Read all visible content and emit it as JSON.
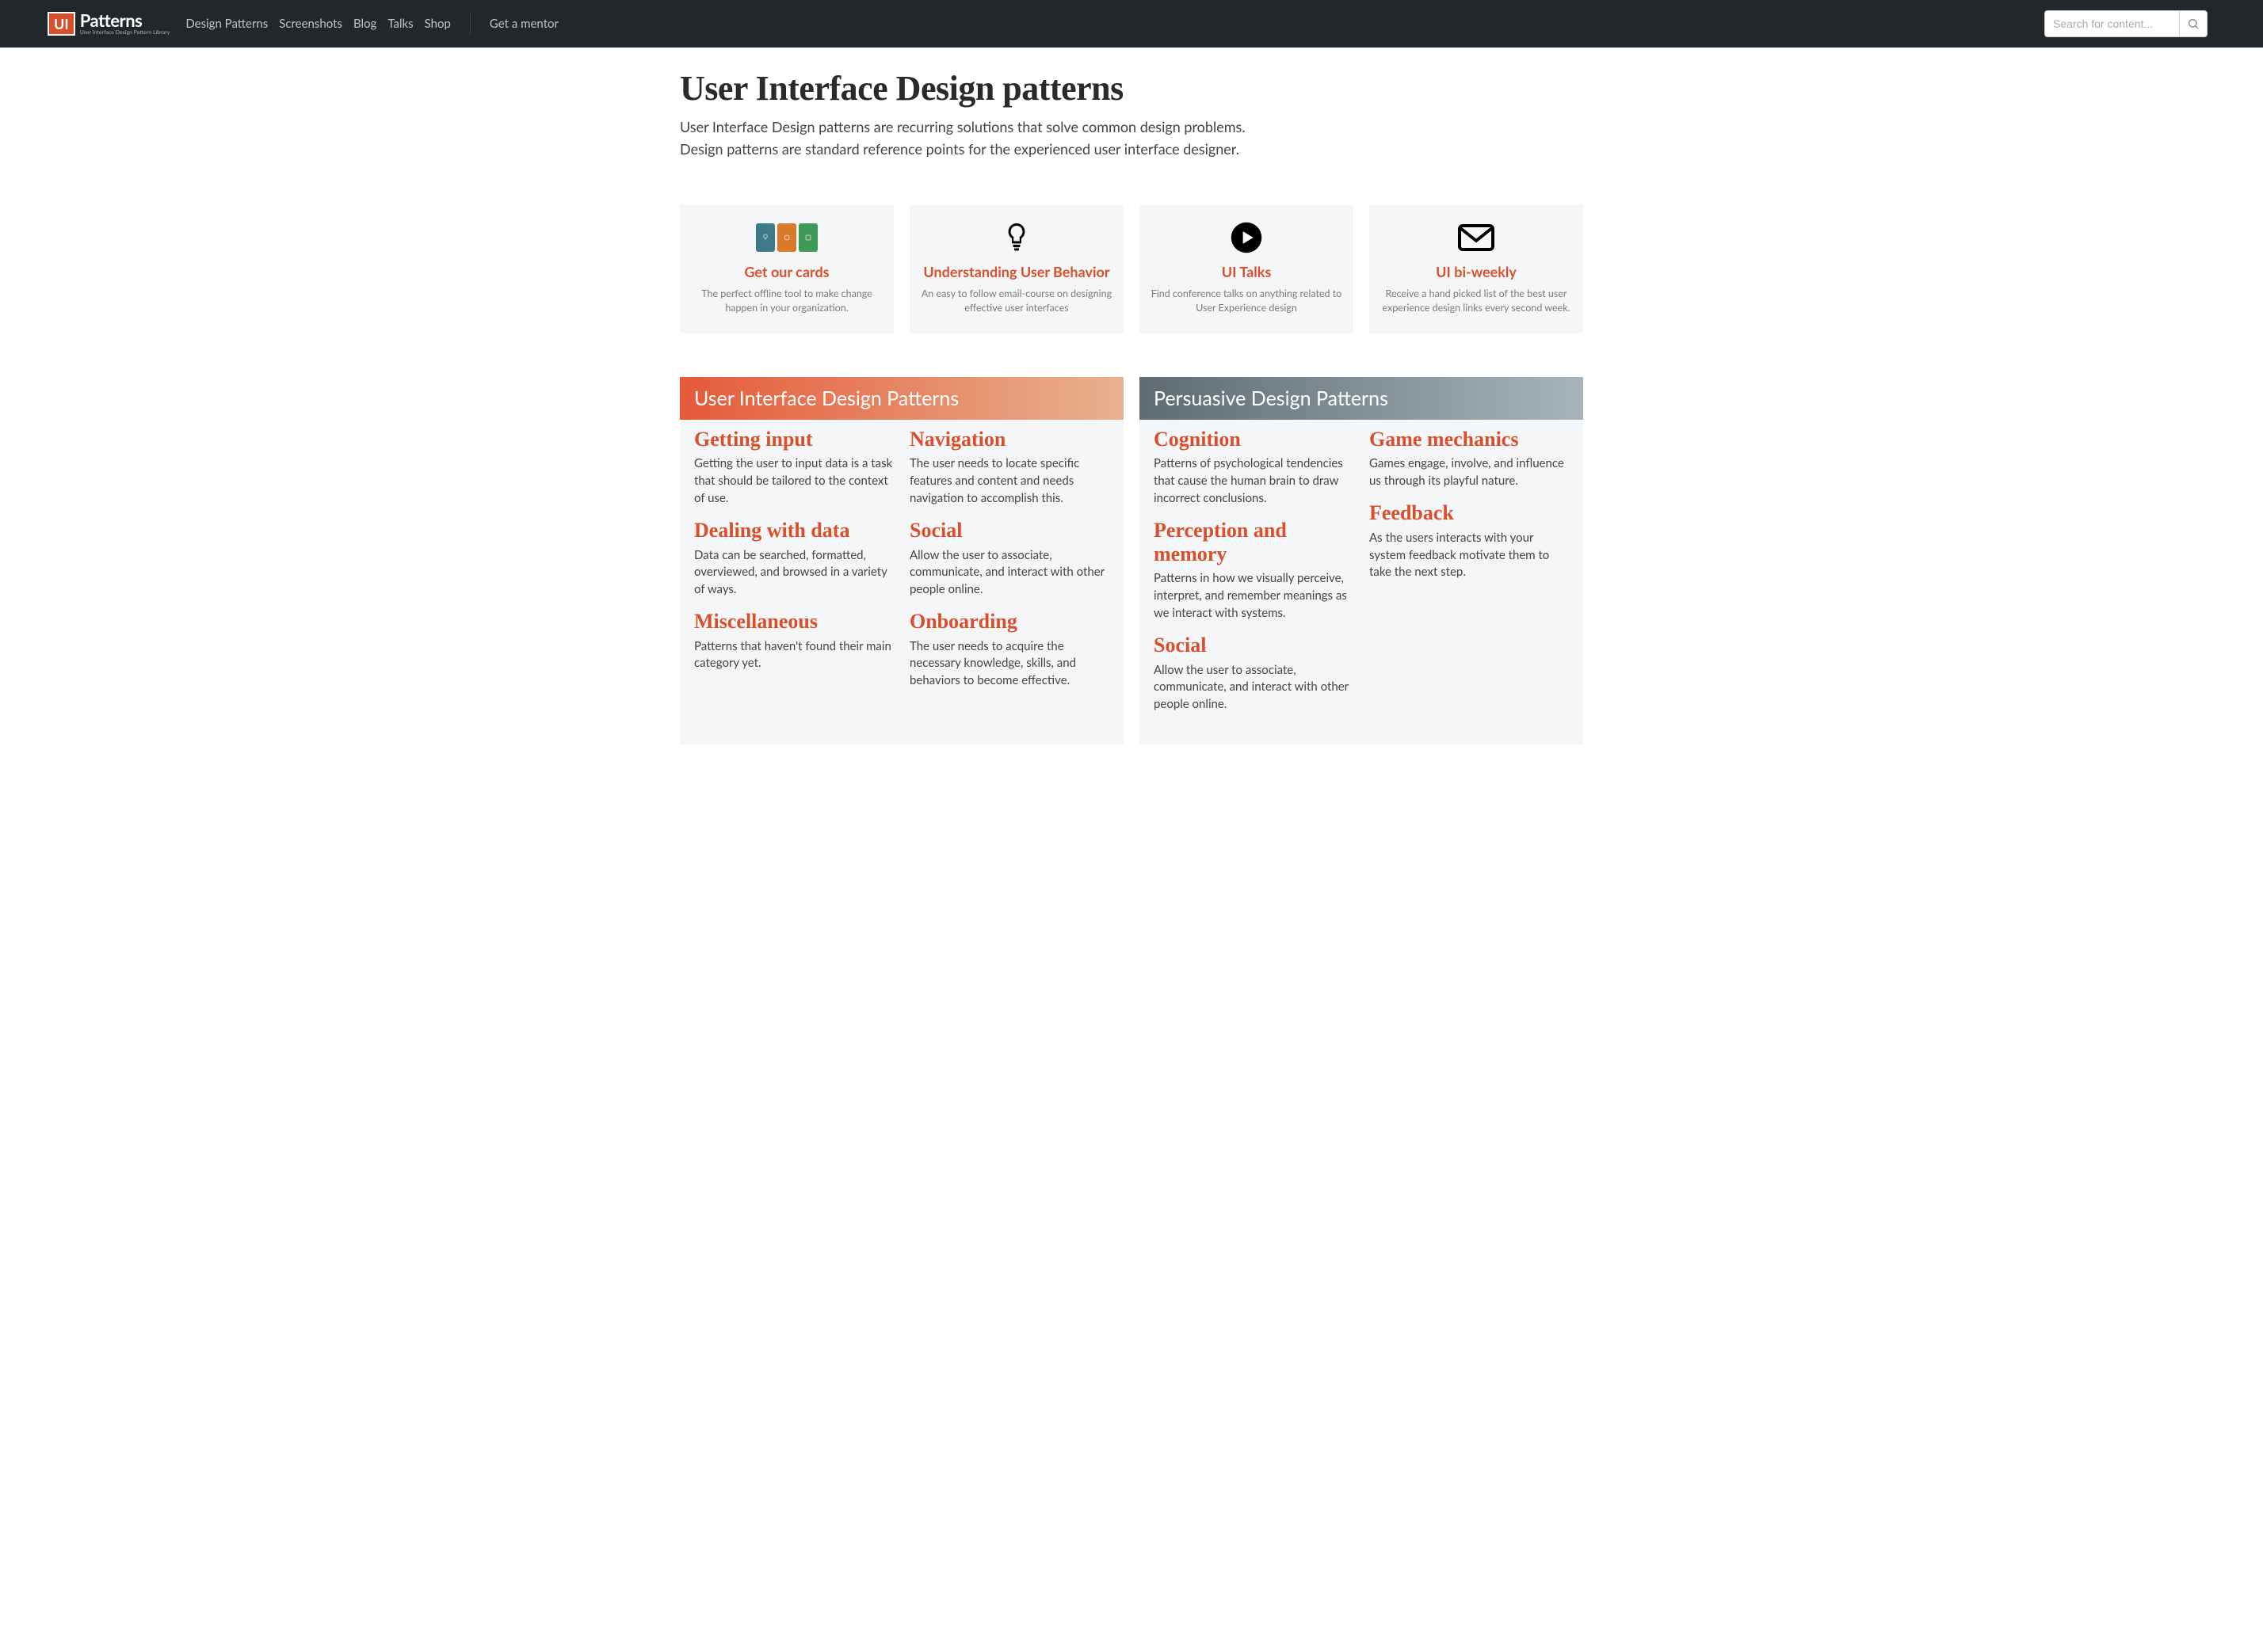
{
  "logo": {
    "badge": "UI",
    "text": "Patterns",
    "subtitle": "User Interface Design Pattern Library"
  },
  "nav": {
    "items": [
      "Design Patterns",
      "Screenshots",
      "Blog",
      "Talks",
      "Shop"
    ],
    "mentor": "Get a mentor"
  },
  "search": {
    "placeholder": "Search for content..."
  },
  "page": {
    "title": "User Interface Design patterns",
    "intro": "User Interface Design patterns are recurring solutions that solve common design problems. Design patterns are standard reference points for the experienced user interface designer."
  },
  "promos": [
    {
      "title": "Get our cards",
      "desc": "The perfect offline tool to make change happen in your organization.",
      "icon": "cards"
    },
    {
      "title": "Understanding User Behavior",
      "desc": "An easy to follow email-course on designing effective user interfaces",
      "icon": "bulb"
    },
    {
      "title": "UI Talks",
      "desc": "Find conference talks on anything related to User Experience design",
      "icon": "play"
    },
    {
      "title": "UI bi-weekly",
      "desc": "Receive a hand picked list of the best user experience design links every second week.",
      "icon": "mail"
    }
  ],
  "sections": [
    {
      "header": "User Interface Design Patterns",
      "style": "orange",
      "col1": [
        {
          "title": "Getting input",
          "desc": "Getting the user to input data is a task that should be tailored to the context of use."
        },
        {
          "title": "Dealing with data",
          "desc": "Data can be searched, formatted, overviewed, and browsed in a variety of ways."
        },
        {
          "title": "Miscellaneous",
          "desc": "Patterns that haven't found their main category yet."
        }
      ],
      "col2": [
        {
          "title": "Navigation",
          "desc": "The user needs to locate specific features and content and needs navigation to accomplish this."
        },
        {
          "title": "Social",
          "desc": "Allow the user to associate, communicate, and interact with other people online."
        },
        {
          "title": "Onboarding",
          "desc": "The user needs to acquire the necessary knowledge, skills, and behaviors to become effective."
        }
      ]
    },
    {
      "header": "Persuasive Design Patterns",
      "style": "gray",
      "col1": [
        {
          "title": "Cognition",
          "desc": "Patterns of psychological tendencies that cause the human brain to draw incorrect conclusions."
        },
        {
          "title": "Perception and memory",
          "desc": "Patterns in how we visually perceive, interpret, and remember meanings as we interact with systems."
        },
        {
          "title": "Social",
          "desc": "Allow the user to associate, communicate, and interact with other people online."
        }
      ],
      "col2": [
        {
          "title": "Game mechanics",
          "desc": "Games engage, involve, and influence us through its playful nature."
        },
        {
          "title": "Feedback",
          "desc": "As the users interacts with your system feedback motivate them to take the next step."
        }
      ]
    }
  ]
}
